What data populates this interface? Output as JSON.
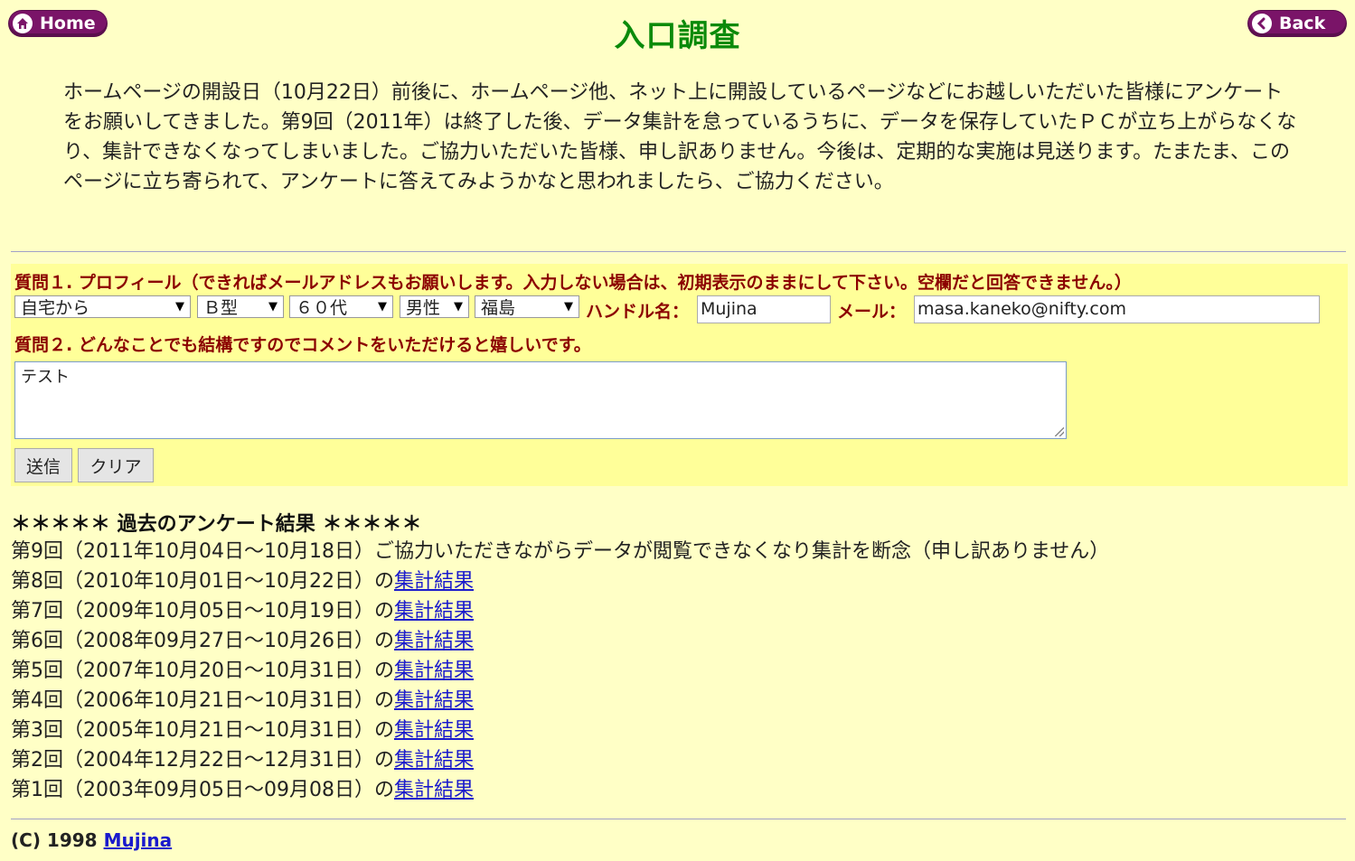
{
  "nav": {
    "home_label": "Home",
    "back_label": "Back"
  },
  "page": {
    "title": "入口調査",
    "intro": "ホームページの開設日（10月22日）前後に、ホームページ他、ネット上に開設しているページなどにお越しいただいた皆様にアンケートをお願いしてきました。第9回（2011年）は終了した後、データ集計を怠っているうちに、データを保存していたＰＣが立ち上がらなくなり、集計できなくなってしまいました。ご協力いただいた皆様、申し訳ありません。今後は、定期的な実施は見送ります。たまたま、このページに立ち寄られて、アンケートに答えてみようかなと思われましたら、ご協力ください。"
  },
  "form": {
    "q1_label": "質問１. プロフィール（できればメールアドレスもお願いします。入力しない場合は、初期表示のままにして下さい。空欄だと回答できません。）",
    "selects": {
      "access": "自宅から",
      "blood": "Ｂ型",
      "age": "６０代",
      "gender": "男性",
      "region": "福島"
    },
    "handle_label": "ハンドル名：",
    "handle_value": "Mujina",
    "email_label": "メール：",
    "email_value": "masa.kaneko@nifty.com",
    "q2_label": "質問２. どんなことでも結構ですのでコメントをいただけると嬉しいです。",
    "comment_value": "テスト",
    "submit_label": "送信",
    "clear_label": "クリア"
  },
  "past": {
    "title": "＊＊＊＊＊ 過去のアンケート結果 ＊＊＊＊＊",
    "round9": "第9回（2011年10月04日～10月18日）ご協力いただきながらデータが閲覧できなくなり集計を断念（申し訳ありません）",
    "link_label": "集計結果",
    "items": [
      {
        "text": "第8回（2010年10月01日～10月22日）の"
      },
      {
        "text": "第7回（2009年10月05日～10月19日）の"
      },
      {
        "text": "第6回（2008年09月27日～10月26日）の"
      },
      {
        "text": "第5回（2007年10月20日～10月31日）の"
      },
      {
        "text": "第4回（2006年10月21日～10月31日）の"
      },
      {
        "text": "第3回（2005年10月21日～10月31日）の"
      },
      {
        "text": "第2回（2004年12月22日～12月31日）の"
      },
      {
        "text": "第1回（2003年09月05日～09月08日）の"
      }
    ]
  },
  "footer": {
    "copyright": "(C) 1998 ",
    "author_link": "Mujina"
  }
}
